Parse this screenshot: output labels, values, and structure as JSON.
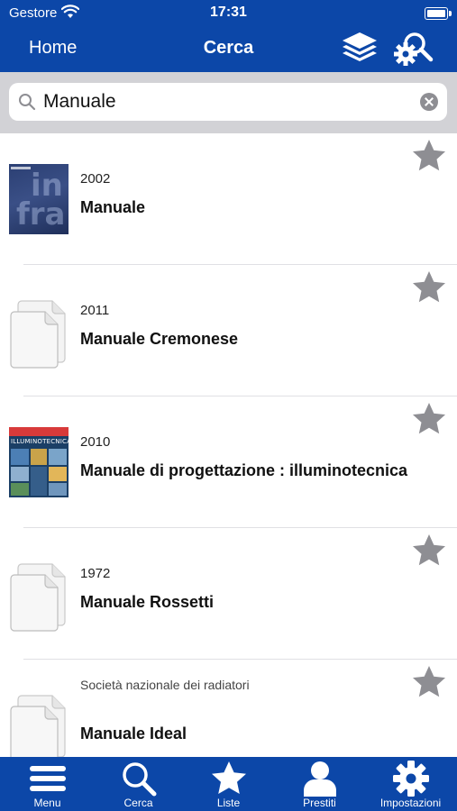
{
  "status_bar": {
    "carrier": "Gestore",
    "time": "17:31"
  },
  "nav": {
    "back_label": "Home",
    "title": "Cerca",
    "icons": [
      "layers-icon",
      "search-settings-icon"
    ]
  },
  "search": {
    "query": "Manuale",
    "placeholder": ""
  },
  "results": [
    {
      "year": "2002",
      "title": "Manuale",
      "cover": "image",
      "favorite": false
    },
    {
      "year": "2011",
      "title": "Manuale Cremonese",
      "cover": "document-placeholder",
      "favorite": false
    },
    {
      "year": "2010",
      "title": "Manuale di progettazione : illuminotecnica",
      "cover": "image",
      "cover_text": "ILLUMINOTECNICA",
      "favorite": false
    },
    {
      "year": "1972",
      "title": "Manuale Rossetti",
      "cover": "document-placeholder",
      "favorite": false
    },
    {
      "subtitle": "Società nazionale dei radiatori",
      "title": "Manuale Ideal",
      "cover": "document-placeholder",
      "favorite": false
    }
  ],
  "tabs": [
    {
      "label": "Menu",
      "icon": "menu-icon"
    },
    {
      "label": "Cerca",
      "icon": "search-icon"
    },
    {
      "label": "Liste",
      "icon": "star-icon"
    },
    {
      "label": "Prestiti",
      "icon": "person-icon"
    },
    {
      "label": "Impostazioni",
      "icon": "gear-icon"
    }
  ],
  "colors": {
    "primary": "#0c47a8",
    "star": "#8e8e93",
    "search_bg": "#d2d2d6"
  }
}
